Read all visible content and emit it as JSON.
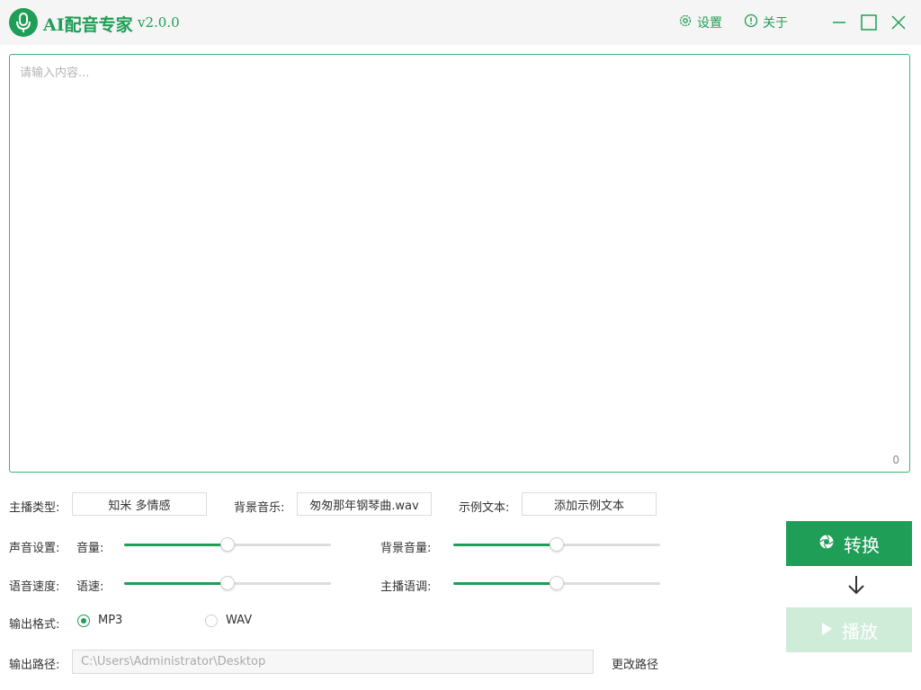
{
  "app": {
    "title": "AI配音专家",
    "version": "v2.0.0",
    "accent_color": "#1e9e56",
    "icon": "microphone-icon"
  },
  "titlebar": {
    "settings": {
      "label": "设置",
      "icon": "gear-icon"
    },
    "about": {
      "label": "关于",
      "icon": "info-icon"
    },
    "window_controls": [
      "minimize-icon",
      "maximize-icon",
      "close-icon"
    ]
  },
  "editor": {
    "placeholder": "请输入内容...",
    "value": "",
    "char_count": "0"
  },
  "options": {
    "anchor_type_label": "主播类型:",
    "anchor_type_value": "知米 多情感",
    "bgm_label": "背景音乐:",
    "bgm_value": "匆匆那年钢琴曲.wav",
    "sample_text_label": "示例文本:",
    "sample_text_button": "添加示例文本"
  },
  "sound": {
    "row_label": "声音设置:",
    "volume_label": "音量:",
    "volume_value": 0.5,
    "bgm_volume_label": "背景音量:",
    "bgm_volume_value": 0.5
  },
  "speed": {
    "row_label": "语音速度:",
    "speed_label": "语速:",
    "speed_value": 0.5,
    "pitch_label": "主播语调:",
    "pitch_value": 0.5
  },
  "format": {
    "row_label": "输出格式:",
    "options": [
      "MP3",
      "WAV"
    ],
    "selected": "MP3"
  },
  "output": {
    "row_label": "输出路径:",
    "placeholder": "C:\\Users\\Administrator\\Desktop",
    "change_label": "更改路径"
  },
  "actions": {
    "convert_label": "转换",
    "convert_icon": "aperture-icon",
    "play_label": "播放",
    "play_icon": "play-icon"
  }
}
